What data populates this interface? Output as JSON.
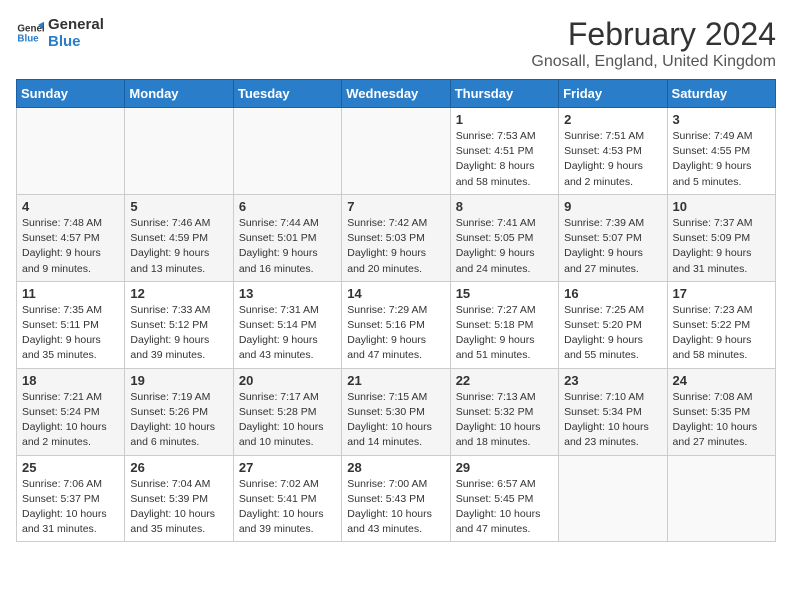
{
  "header": {
    "logo_line1": "General",
    "logo_line2": "Blue",
    "title": "February 2024",
    "subtitle": "Gnosall, England, United Kingdom"
  },
  "columns": [
    "Sunday",
    "Monday",
    "Tuesday",
    "Wednesday",
    "Thursday",
    "Friday",
    "Saturday"
  ],
  "weeks": [
    [
      {
        "day": "",
        "info": ""
      },
      {
        "day": "",
        "info": ""
      },
      {
        "day": "",
        "info": ""
      },
      {
        "day": "",
        "info": ""
      },
      {
        "day": "1",
        "info": "Sunrise: 7:53 AM\nSunset: 4:51 PM\nDaylight: 8 hours\nand 58 minutes."
      },
      {
        "day": "2",
        "info": "Sunrise: 7:51 AM\nSunset: 4:53 PM\nDaylight: 9 hours\nand 2 minutes."
      },
      {
        "day": "3",
        "info": "Sunrise: 7:49 AM\nSunset: 4:55 PM\nDaylight: 9 hours\nand 5 minutes."
      }
    ],
    [
      {
        "day": "4",
        "info": "Sunrise: 7:48 AM\nSunset: 4:57 PM\nDaylight: 9 hours\nand 9 minutes."
      },
      {
        "day": "5",
        "info": "Sunrise: 7:46 AM\nSunset: 4:59 PM\nDaylight: 9 hours\nand 13 minutes."
      },
      {
        "day": "6",
        "info": "Sunrise: 7:44 AM\nSunset: 5:01 PM\nDaylight: 9 hours\nand 16 minutes."
      },
      {
        "day": "7",
        "info": "Sunrise: 7:42 AM\nSunset: 5:03 PM\nDaylight: 9 hours\nand 20 minutes."
      },
      {
        "day": "8",
        "info": "Sunrise: 7:41 AM\nSunset: 5:05 PM\nDaylight: 9 hours\nand 24 minutes."
      },
      {
        "day": "9",
        "info": "Sunrise: 7:39 AM\nSunset: 5:07 PM\nDaylight: 9 hours\nand 27 minutes."
      },
      {
        "day": "10",
        "info": "Sunrise: 7:37 AM\nSunset: 5:09 PM\nDaylight: 9 hours\nand 31 minutes."
      }
    ],
    [
      {
        "day": "11",
        "info": "Sunrise: 7:35 AM\nSunset: 5:11 PM\nDaylight: 9 hours\nand 35 minutes."
      },
      {
        "day": "12",
        "info": "Sunrise: 7:33 AM\nSunset: 5:12 PM\nDaylight: 9 hours\nand 39 minutes."
      },
      {
        "day": "13",
        "info": "Sunrise: 7:31 AM\nSunset: 5:14 PM\nDaylight: 9 hours\nand 43 minutes."
      },
      {
        "day": "14",
        "info": "Sunrise: 7:29 AM\nSunset: 5:16 PM\nDaylight: 9 hours\nand 47 minutes."
      },
      {
        "day": "15",
        "info": "Sunrise: 7:27 AM\nSunset: 5:18 PM\nDaylight: 9 hours\nand 51 minutes."
      },
      {
        "day": "16",
        "info": "Sunrise: 7:25 AM\nSunset: 5:20 PM\nDaylight: 9 hours\nand 55 minutes."
      },
      {
        "day": "17",
        "info": "Sunrise: 7:23 AM\nSunset: 5:22 PM\nDaylight: 9 hours\nand 58 minutes."
      }
    ],
    [
      {
        "day": "18",
        "info": "Sunrise: 7:21 AM\nSunset: 5:24 PM\nDaylight: 10 hours\nand 2 minutes."
      },
      {
        "day": "19",
        "info": "Sunrise: 7:19 AM\nSunset: 5:26 PM\nDaylight: 10 hours\nand 6 minutes."
      },
      {
        "day": "20",
        "info": "Sunrise: 7:17 AM\nSunset: 5:28 PM\nDaylight: 10 hours\nand 10 minutes."
      },
      {
        "day": "21",
        "info": "Sunrise: 7:15 AM\nSunset: 5:30 PM\nDaylight: 10 hours\nand 14 minutes."
      },
      {
        "day": "22",
        "info": "Sunrise: 7:13 AM\nSunset: 5:32 PM\nDaylight: 10 hours\nand 18 minutes."
      },
      {
        "day": "23",
        "info": "Sunrise: 7:10 AM\nSunset: 5:34 PM\nDaylight: 10 hours\nand 23 minutes."
      },
      {
        "day": "24",
        "info": "Sunrise: 7:08 AM\nSunset: 5:35 PM\nDaylight: 10 hours\nand 27 minutes."
      }
    ],
    [
      {
        "day": "25",
        "info": "Sunrise: 7:06 AM\nSunset: 5:37 PM\nDaylight: 10 hours\nand 31 minutes."
      },
      {
        "day": "26",
        "info": "Sunrise: 7:04 AM\nSunset: 5:39 PM\nDaylight: 10 hours\nand 35 minutes."
      },
      {
        "day": "27",
        "info": "Sunrise: 7:02 AM\nSunset: 5:41 PM\nDaylight: 10 hours\nand 39 minutes."
      },
      {
        "day": "28",
        "info": "Sunrise: 7:00 AM\nSunset: 5:43 PM\nDaylight: 10 hours\nand 43 minutes."
      },
      {
        "day": "29",
        "info": "Sunrise: 6:57 AM\nSunset: 5:45 PM\nDaylight: 10 hours\nand 47 minutes."
      },
      {
        "day": "",
        "info": ""
      },
      {
        "day": "",
        "info": ""
      }
    ]
  ]
}
